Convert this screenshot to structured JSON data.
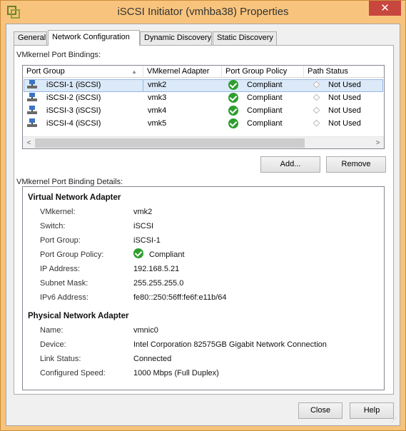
{
  "window": {
    "title": "iSCSI Initiator (vmhba38) Properties",
    "close_glyph": "✕"
  },
  "tabs": [
    "General",
    "Network Configuration",
    "Dynamic Discovery",
    "Static Discovery"
  ],
  "active_tab": "Network Configuration",
  "bindings": {
    "label": "VMkernel Port Bindings:",
    "columns": [
      "Port Group",
      "VMkernel Adapter",
      "Port Group Policy",
      "Path Status"
    ],
    "sort_indicator": "▲",
    "rows": [
      {
        "port_group": "iSCSI-1 (iSCSI)",
        "adapter": "vmk2",
        "policy": "Compliant",
        "path_status": "Not Used",
        "selected": true
      },
      {
        "port_group": "iSCSI-2 (iSCSI)",
        "adapter": "vmk3",
        "policy": "Compliant",
        "path_status": "Not Used",
        "selected": false
      },
      {
        "port_group": "iSCSI-3 (iSCSI)",
        "adapter": "vmk4",
        "policy": "Compliant",
        "path_status": "Not Used",
        "selected": false
      },
      {
        "port_group": "iSCSI-4 (iSCSI)",
        "adapter": "vmk5",
        "policy": "Compliant",
        "path_status": "Not Used",
        "selected": false
      }
    ],
    "scroll_left": "<",
    "scroll_right": ">"
  },
  "buttons": {
    "add": "Add...",
    "remove": "Remove",
    "close": "Close",
    "help": "Help"
  },
  "details": {
    "label": "VMkernel Port Binding Details:",
    "virtual_heading": "Virtual Network Adapter",
    "virtual": [
      {
        "key": "VMkernel:",
        "value": "vmk2"
      },
      {
        "key": "Switch:",
        "value": "iSCSI"
      },
      {
        "key": "Port Group:",
        "value": "iSCSI-1"
      },
      {
        "key": "Port Group Policy:",
        "value": "Compliant"
      },
      {
        "key": "IP Address:",
        "value": "192.168.5.21"
      },
      {
        "key": "Subnet Mask:",
        "value": "255.255.255.0"
      },
      {
        "key": "IPv6 Address:",
        "value": "fe80::250:56ff:fe6f:e11b/64"
      }
    ],
    "physical_heading": "Physical Network Adapter",
    "physical": [
      {
        "key": "Name:",
        "value": "vmnic0"
      },
      {
        "key": "Device:",
        "value": "Intel Corporation 82575GB Gigabit Network Connection"
      },
      {
        "key": "Link Status:",
        "value": "Connected"
      },
      {
        "key": "Configured Speed:",
        "value": "1000 Mbps (Full Duplex)"
      }
    ]
  },
  "icons": {
    "app": "vmware-icon",
    "port_group": "network-port-icon",
    "compliant": "check-circle-icon",
    "not_used": "diamond-icon"
  },
  "colors": {
    "title_bar": "#f8c47d",
    "close_button": "#c7463e",
    "compliant": "#2e9e2e",
    "selection": "#dbe9f9"
  }
}
